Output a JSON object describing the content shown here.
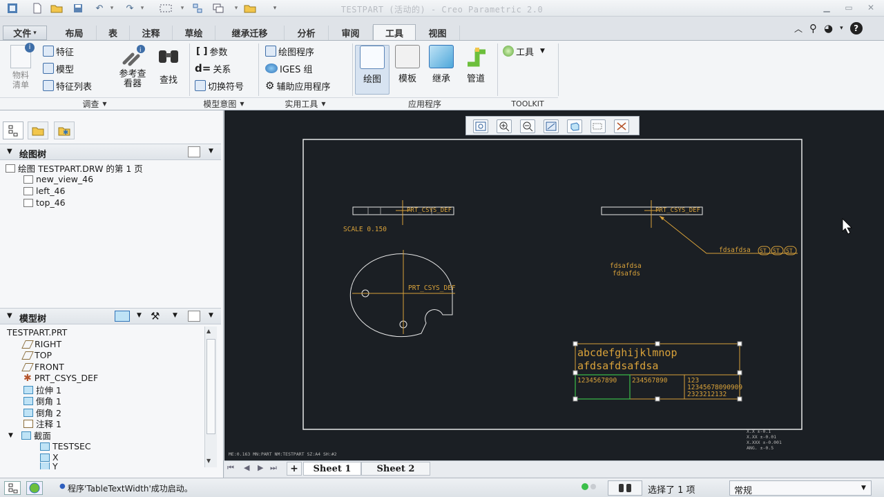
{
  "window": {
    "title": "TESTPART (活动的) - Creo Parametric 2.0"
  },
  "tabs": [
    {
      "label": "文件",
      "caret": "▾"
    },
    {
      "label": "布局"
    },
    {
      "label": "表"
    },
    {
      "label": "注释"
    },
    {
      "label": "草绘"
    },
    {
      "label": "继承迁移"
    },
    {
      "label": "分析"
    },
    {
      "label": "审阅"
    },
    {
      "label": "工具"
    },
    {
      "label": "视图"
    }
  ],
  "ribbon": {
    "bom_label": "物料\n清单",
    "feature": "特征",
    "model": "模型",
    "feature_list": "特征列表",
    "ref_viewer": "参考查\n看器",
    "find": "查找",
    "params": "参数",
    "relations": "关系",
    "switch_symbol": "切换符号",
    "drawing_program": "绘图程序",
    "iges_group": "IGES 组",
    "aux_app": "辅助应用程序",
    "drawing": "绘图",
    "template": "模板",
    "inherit": "继承",
    "piping": "管道",
    "tools": "工具",
    "groups": {
      "investigate": "调查",
      "model_intent": "模型意图",
      "utilities": "实用工具",
      "applications": "应用程序",
      "toolkit": "TOOLKIT"
    }
  },
  "drawing_tree": {
    "header": "绘图树",
    "items": [
      "绘图 TESTPART.DRW 的第 1 页",
      "new_view_46",
      "left_46",
      "top_46"
    ]
  },
  "model_tree": {
    "header": "模型树",
    "root": "TESTPART.PRT",
    "items": [
      "RIGHT",
      "TOP",
      "FRONT",
      "PRT_CSYS_DEF",
      "拉伸 1",
      "倒角 1",
      "倒角 2",
      "注释 1",
      "截面",
      "TESTSEC",
      "X",
      "Y"
    ]
  },
  "drawing": {
    "csys_label": "PRT_CSYS_DEF",
    "scale": "SCALE  0.150",
    "leader_note": "fdsafdsa",
    "st_symbol": "ST",
    "note_line1": "fdsafdsa",
    "note_line2": "fdsafds",
    "table": {
      "row1": "abcdefghijklmnop",
      "row2": "afdsafdsafdsa",
      "c1": "1234567890",
      "c2": "234567890",
      "c3a": "123",
      "c3b": "12345678090909",
      "c3c": "2323212132"
    },
    "format_info": "ME:0.163     MN:PART   NM:TESTPART   SZ:A4   SH:#2",
    "tolerances": [
      "X.X    ±-0.1",
      "X.XX   ±-0.01",
      "X.XXX  ±-0.001",
      "ANG.   ±-0.5"
    ]
  },
  "sheets": [
    "Sheet 1",
    "Sheet 2"
  ],
  "status": {
    "message": "程序'TableTextWidth'成功启动。",
    "selection": "选择了 1 项",
    "filter": "常规"
  },
  "colors": {
    "drawing_bg": "#1b1f24",
    "annotation": "#d9a23a",
    "geometry": "#e8e8e8",
    "selection": "#3bbf4a"
  }
}
